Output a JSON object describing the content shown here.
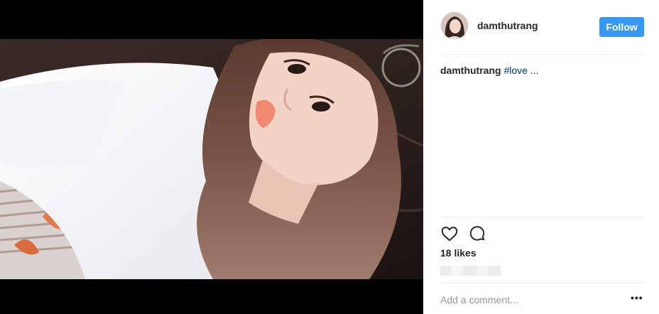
{
  "post": {
    "username": "damthutrang",
    "follow_label": "Follow",
    "caption_user": "damthutrang",
    "caption_tag": "#love",
    "caption_more": " ...",
    "likes": "18 likes",
    "comment_placeholder": "Add a comment...",
    "more_label": "•••"
  },
  "icons": {
    "like": "heart-icon",
    "comment": "comment-icon",
    "more": "more-options-icon"
  },
  "colors": {
    "follow_button": "#3897f0",
    "hashtag": "#003569",
    "divider": "#efefef"
  }
}
